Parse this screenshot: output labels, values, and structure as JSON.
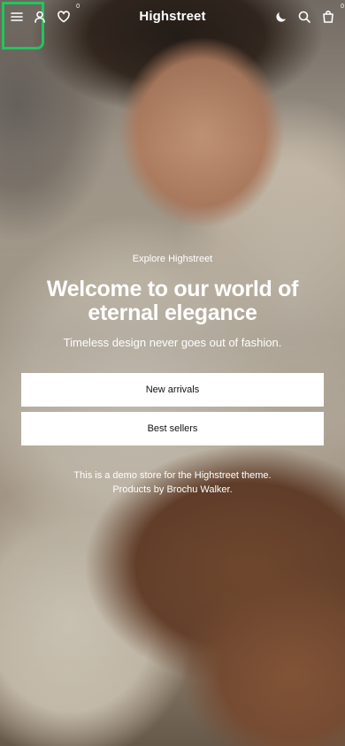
{
  "header": {
    "logo": "Highstreet",
    "wishlist_count": "0",
    "cart_count": "0",
    "icons": {
      "menu": "menu-icon",
      "account": "user-icon",
      "wishlist": "heart-icon",
      "theme": "moon-icon",
      "search": "search-icon",
      "cart": "bag-icon"
    }
  },
  "hero": {
    "eyebrow": "Explore Highstreet",
    "headline": "Welcome to our world of eternal elegance",
    "subtitle": "Timeless design never goes out of fashion.",
    "buttons": [
      "New arrivals",
      "Best sellers"
    ],
    "note_line1": "This is a demo store for the Highstreet theme.",
    "note_line2": "Products by Brochu Walker."
  },
  "colors": {
    "focus_ring": "#22c55e",
    "button_bg": "#ffffff",
    "button_text": "#111111",
    "overlay_text": "#ffffff"
  }
}
